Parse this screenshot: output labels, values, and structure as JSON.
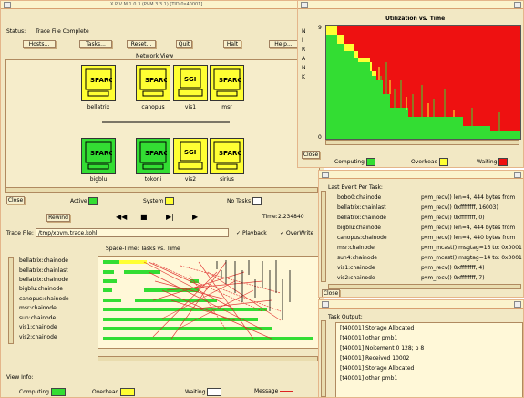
{
  "main": {
    "title": "X P V M 1.0.3 (PVM 3.3.1) [TID 0x40001]",
    "status_label": "Status:",
    "status_value": "Trace File Complete",
    "buttons": [
      "Hosts...",
      "Tasks...",
      "Reset...",
      "Quit",
      "Halt",
      "Help..."
    ],
    "network_view_title": "Network View",
    "hosts_top": [
      "bellatrix",
      "canopus",
      "vis1",
      "msr"
    ],
    "hosts_bottom": [
      "bigblu",
      "tokoni",
      "vis2",
      "sirius"
    ],
    "close": "Close",
    "legend": {
      "active": "Active",
      "system": "System",
      "no_tasks": "No Tasks"
    },
    "playback": {
      "rewind": "Rewind",
      "time_label": "Time:",
      "time_value": "2.234840",
      "trace_file_label": "Trace File:",
      "trace_file_value": "/tmp/xpvm.trace.kohl",
      "playback_opt": "Playback",
      "overwrite_opt": "OverWrite"
    },
    "space_time": {
      "title": "Space-Time: Tasks vs. Time",
      "tasks": [
        "bellatrix:chainode",
        "bellatrix:chainlast",
        "bellatrix:chainode",
        "bigblu:chainode",
        "canopus:chainode",
        "msr:chainode",
        "sun:chainode",
        "vis1:chainode",
        "vis2:chainode"
      ]
    },
    "view_info_label": "View Info:",
    "bottom_legend": {
      "computing": "Computing",
      "overhead": "Overhead",
      "waiting": "Waiting",
      "message": "Message"
    }
  },
  "utilization": {
    "title": "Utilization vs. Time",
    "axis_letters": [
      "N",
      "I",
      "R",
      "A",
      "N",
      "K"
    ],
    "ymax": "9",
    "ymin": "0",
    "close": "Close",
    "legend": {
      "computing": "Computing",
      "overhead": "Overhead",
      "waiting": "Waiting"
    }
  },
  "last_event": {
    "title": "Last Event Per Task:",
    "rows": [
      {
        "task": "bobo0:chainode",
        "event": "pvm_recv() len=4, 444 bytes from"
      },
      {
        "task": "bellatrix:chainlast",
        "event": "pvm_recv() 0xffffffff, 16003)"
      },
      {
        "task": "bellatrix:chainode",
        "event": "pvm_recv() 0xffffffff, 0)"
      },
      {
        "task": "bigblu:chainode",
        "event": "pvm_recv() len=4, 444 bytes from"
      },
      {
        "task": "canopus:chainode",
        "event": "pvm_recv() len=4, 440 bytes from"
      },
      {
        "task": "msr:chainode",
        "event": "pvm_mcast() msgtag=16 to: 0x0001"
      },
      {
        "task": "sun4:chainode",
        "event": "pvm_mcast() msgtag=14 to: 0x0001"
      },
      {
        "task": "vis1:chainode",
        "event": "pvm_recv() 0xffffffff, 4)"
      },
      {
        "task": "vis2:chainode",
        "event": "pvm_recv() 0xffffffff, 7)"
      }
    ],
    "close": "Close"
  },
  "task_output": {
    "title": "Task Output:",
    "lines": [
      "[t40001] Storage Allocated",
      "[t40001] other pmb1",
      "[t40001] Noitement 0 128; p 8",
      "[t40001] Received 10002",
      "[t40001] Storage Allocated",
      "[t40001] other pmb1"
    ]
  },
  "colors": {
    "computing": "#33dd33",
    "overhead": "#ffff33",
    "waiting": "#ee1111",
    "panel": "#f2e8c4",
    "border": "#e4b58a",
    "titlebar": "#fbf3cc"
  }
}
